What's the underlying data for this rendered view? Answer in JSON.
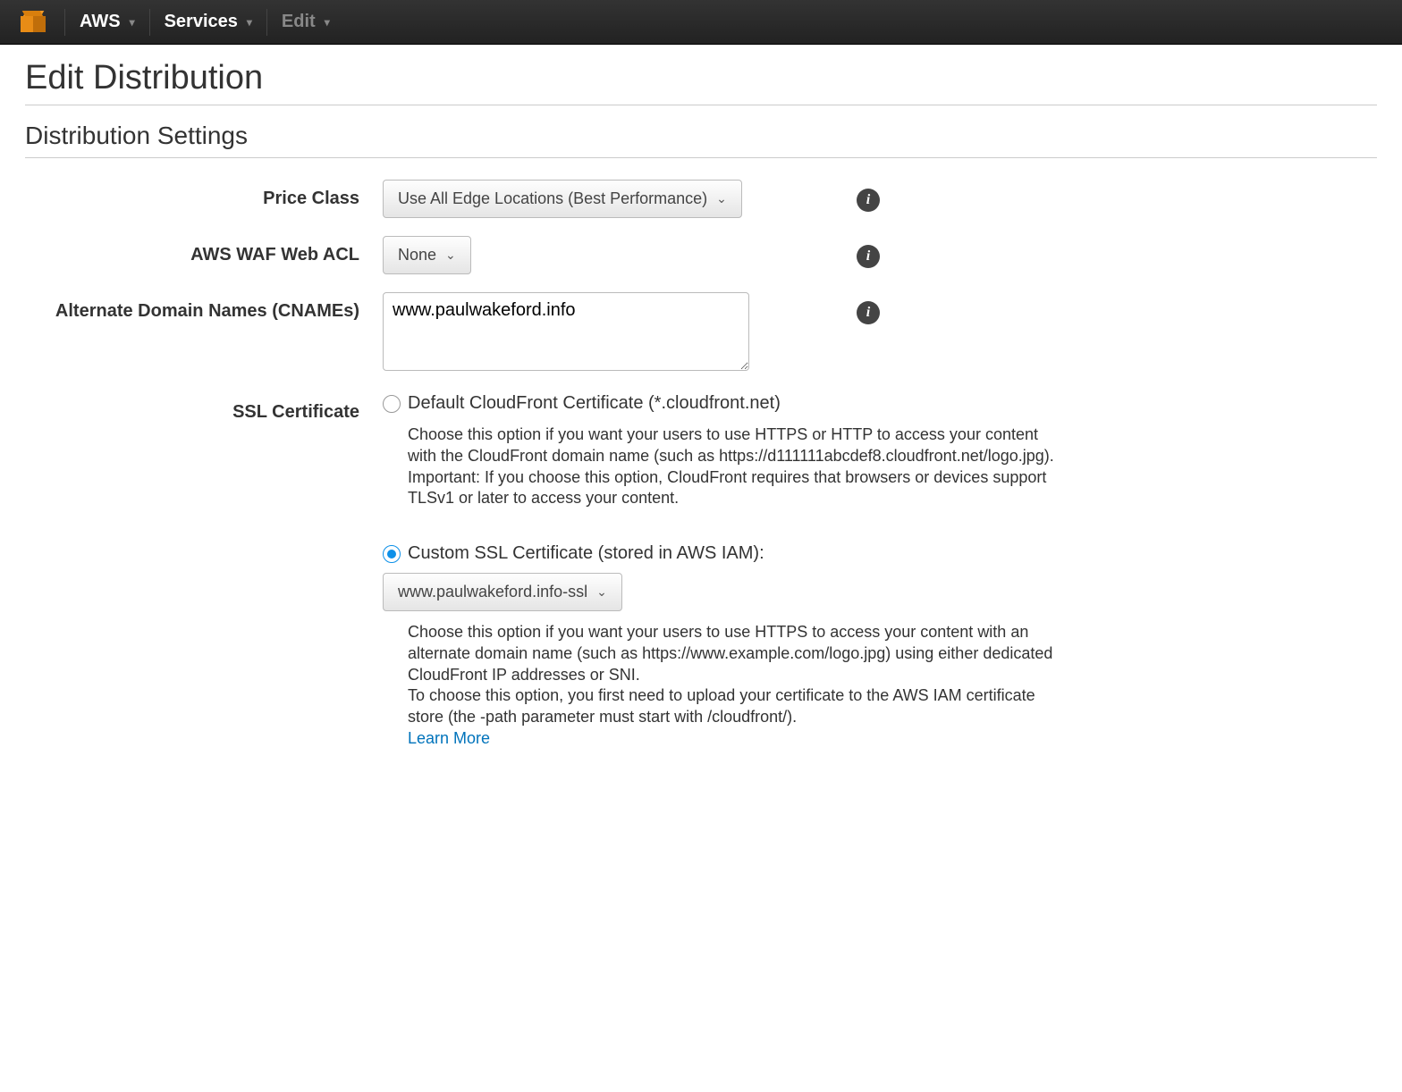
{
  "nav": {
    "aws": "AWS",
    "services": "Services",
    "edit": "Edit"
  },
  "page": {
    "title": "Edit Distribution",
    "section": "Distribution Settings"
  },
  "form": {
    "price_class": {
      "label": "Price Class",
      "value": "Use All Edge Locations (Best Performance)"
    },
    "waf": {
      "label": "AWS WAF Web ACL",
      "value": "None"
    },
    "cnames": {
      "label": "Alternate Domain Names (CNAMEs)",
      "value": "www.paulwakeford.info"
    },
    "ssl": {
      "label": "SSL Certificate",
      "default": {
        "label": "Default CloudFront Certificate (*.cloudfront.net)",
        "help1": "Choose this option if you want your users to use HTTPS or HTTP to access your content with the CloudFront domain name (such as https://d111111abcdef8.cloudfront.net/logo.jpg).",
        "help2": "Important: If you choose this option, CloudFront requires that browsers or devices support TLSv1 or later to access your content."
      },
      "custom": {
        "label": "Custom SSL Certificate (stored in AWS IAM):",
        "selected_cert": "www.paulwakeford.info-ssl",
        "help1": "Choose this option if you want your users to use HTTPS to access your content with an alternate domain name (such as https://www.example.com/logo.jpg) using either dedicated CloudFront IP addresses or SNI.",
        "help2": "To choose this option, you first need to upload your certificate to the AWS IAM certificate store (the -path parameter must start with /cloudfront/).",
        "learn_more": "Learn More"
      }
    }
  }
}
